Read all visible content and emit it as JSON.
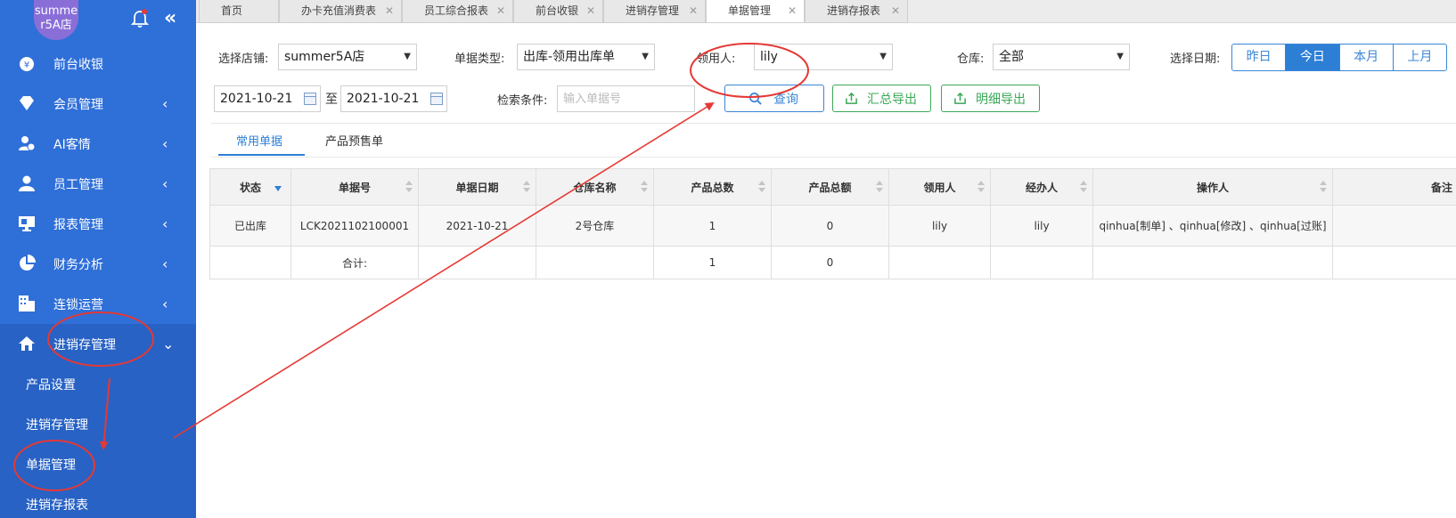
{
  "sidebar": {
    "store_avatar_text": [
      "summe",
      "r5A店"
    ],
    "menu": [
      {
        "label": "前台收银",
        "icon": "cashier-icon",
        "arrow": ""
      },
      {
        "label": "会员管理",
        "icon": "diamond-icon",
        "arrow": "‹"
      },
      {
        "label": "AI客情",
        "icon": "ai-user-icon",
        "arrow": "‹"
      },
      {
        "label": "员工管理",
        "icon": "user-icon",
        "arrow": "‹"
      },
      {
        "label": "报表管理",
        "icon": "monitor-icon",
        "arrow": "‹"
      },
      {
        "label": "财务分析",
        "icon": "pie-chart-icon",
        "arrow": "‹"
      },
      {
        "label": "连锁运营",
        "icon": "building-icon",
        "arrow": "‹"
      },
      {
        "label": "进销存管理",
        "icon": "home-icon",
        "arrow": "⌄"
      }
    ],
    "submenu": [
      "产品设置",
      "进销存管理",
      "单据管理",
      "进销存报表"
    ]
  },
  "tabs": [
    {
      "label": "首页",
      "closable": false
    },
    {
      "label": "办卡充值消费表",
      "closable": true
    },
    {
      "label": "员工综合报表",
      "closable": true
    },
    {
      "label": "前台收银",
      "closable": true
    },
    {
      "label": "进销存管理",
      "closable": true
    },
    {
      "label": "单据管理",
      "closable": true,
      "active": true
    },
    {
      "label": "进销存报表",
      "closable": true
    }
  ],
  "filters": {
    "store_label": "选择店铺:",
    "store_value": "summer5A店",
    "doc_type_label": "单据类型:",
    "doc_type_value": "出库-领用出库单",
    "receiver_label": "领用人:",
    "receiver_value": "lily",
    "warehouse_label": "仓库:",
    "warehouse_value": "全部",
    "date_label": "选择日期:",
    "date_options": [
      "昨日",
      "今日",
      "本月",
      "上月"
    ],
    "date_selected": "今日",
    "date_from": "2021-10-21",
    "date_sep": "至",
    "date_to": "2021-10-21",
    "search_label": "检索条件:",
    "search_placeholder": "输入单据号",
    "query_button": "查询",
    "export_summary_button": "汇总导出",
    "export_detail_button": "明细导出"
  },
  "subtabs": [
    "常用单据",
    "产品预售单"
  ],
  "table": {
    "headers": [
      "状态",
      "单据号",
      "单据日期",
      "仓库名称",
      "产品总数",
      "产品总额",
      "领用人",
      "经办人",
      "操作人",
      "备注"
    ],
    "rows": [
      [
        "已出库",
        "LCK2021102100001",
        "2021-10-21",
        "2号仓库",
        "1",
        "0",
        "lily",
        "lily",
        "qinhua[制单] 、qinhua[修改] 、qinhua[过账]",
        ""
      ]
    ],
    "total_row": [
      "",
      "合计:",
      "",
      "",
      "1",
      "0",
      "",
      "",
      "",
      ""
    ]
  },
  "colors": {
    "sidebar": "#2f6fd8",
    "accent": "#2d7fd6",
    "green": "#3aa857",
    "annotation": "#e53935"
  }
}
